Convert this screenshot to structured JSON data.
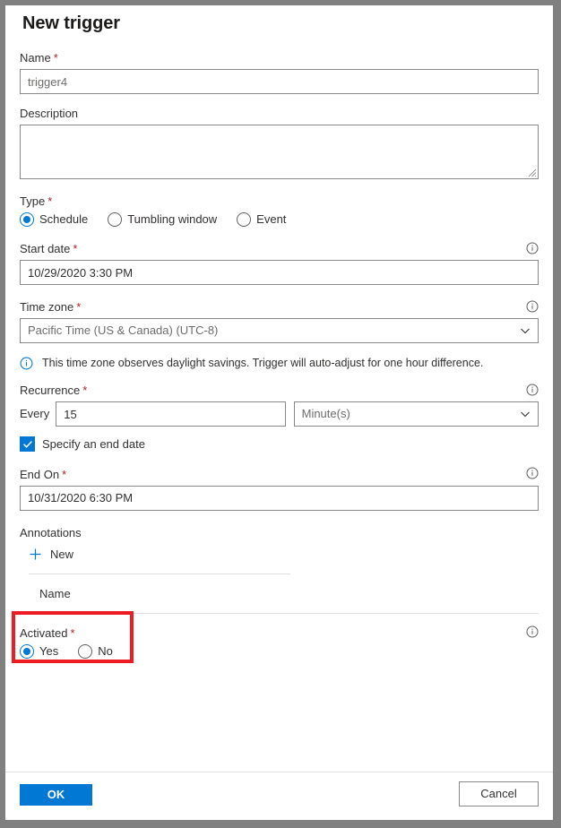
{
  "panel": {
    "title": "New trigger"
  },
  "colors": {
    "accent": "#0078d4",
    "required_asterisk": "#a4262c",
    "highlight_box": "#ee1b24",
    "border": "#8a8886",
    "divider": "#e1dfdd",
    "frame": "#808080",
    "text": "#323130",
    "muted_text": "#6e6c6b"
  },
  "fields": {
    "name": {
      "label": "Name",
      "required": "*",
      "value": "trigger4"
    },
    "description": {
      "label": "Description",
      "value": "",
      "placeholder": ""
    },
    "type": {
      "label": "Type",
      "required": "*",
      "options": [
        {
          "label": "Schedule",
          "selected": true
        },
        {
          "label": "Tumbling window",
          "selected": false
        },
        {
          "label": "Event",
          "selected": false
        }
      ]
    },
    "start_date": {
      "label": "Start date",
      "required": "*",
      "value": "10/29/2020 3:30 PM",
      "info_icon": "info-icon"
    },
    "time_zone": {
      "label": "Time zone",
      "required": "*",
      "value": "Pacific Time (US & Canada) (UTC-8)",
      "info_icon": "info-icon",
      "chevron_icon": "chevron-down-icon"
    },
    "daylight_notice": {
      "icon": "info-icon",
      "text": "This time zone observes daylight savings. Trigger will auto-adjust for one hour difference."
    },
    "recurrence": {
      "label": "Recurrence",
      "required": "*",
      "every_label": "Every",
      "interval_value": "15",
      "unit_value": "Minute(s)",
      "info_icon": "info-icon",
      "chevron_icon": "chevron-down-icon"
    },
    "specify_end_date": {
      "label": "Specify an end date",
      "checked": true,
      "icon": "checkmark-icon"
    },
    "end_on": {
      "label": "End On",
      "required": "*",
      "value": "10/31/2020 6:30 PM",
      "info_icon": "info-icon"
    },
    "annotations": {
      "label": "Annotations",
      "new_button_label": "New",
      "new_button_icon": "plus-icon",
      "column_header_name": "Name",
      "rows": []
    },
    "activated": {
      "label": "Activated",
      "required": "*",
      "info_icon": "info-icon",
      "options": [
        {
          "label": "Yes",
          "selected": true
        },
        {
          "label": "No",
          "selected": false
        }
      ]
    }
  },
  "footer": {
    "ok_label": "OK",
    "cancel_label": "Cancel"
  }
}
